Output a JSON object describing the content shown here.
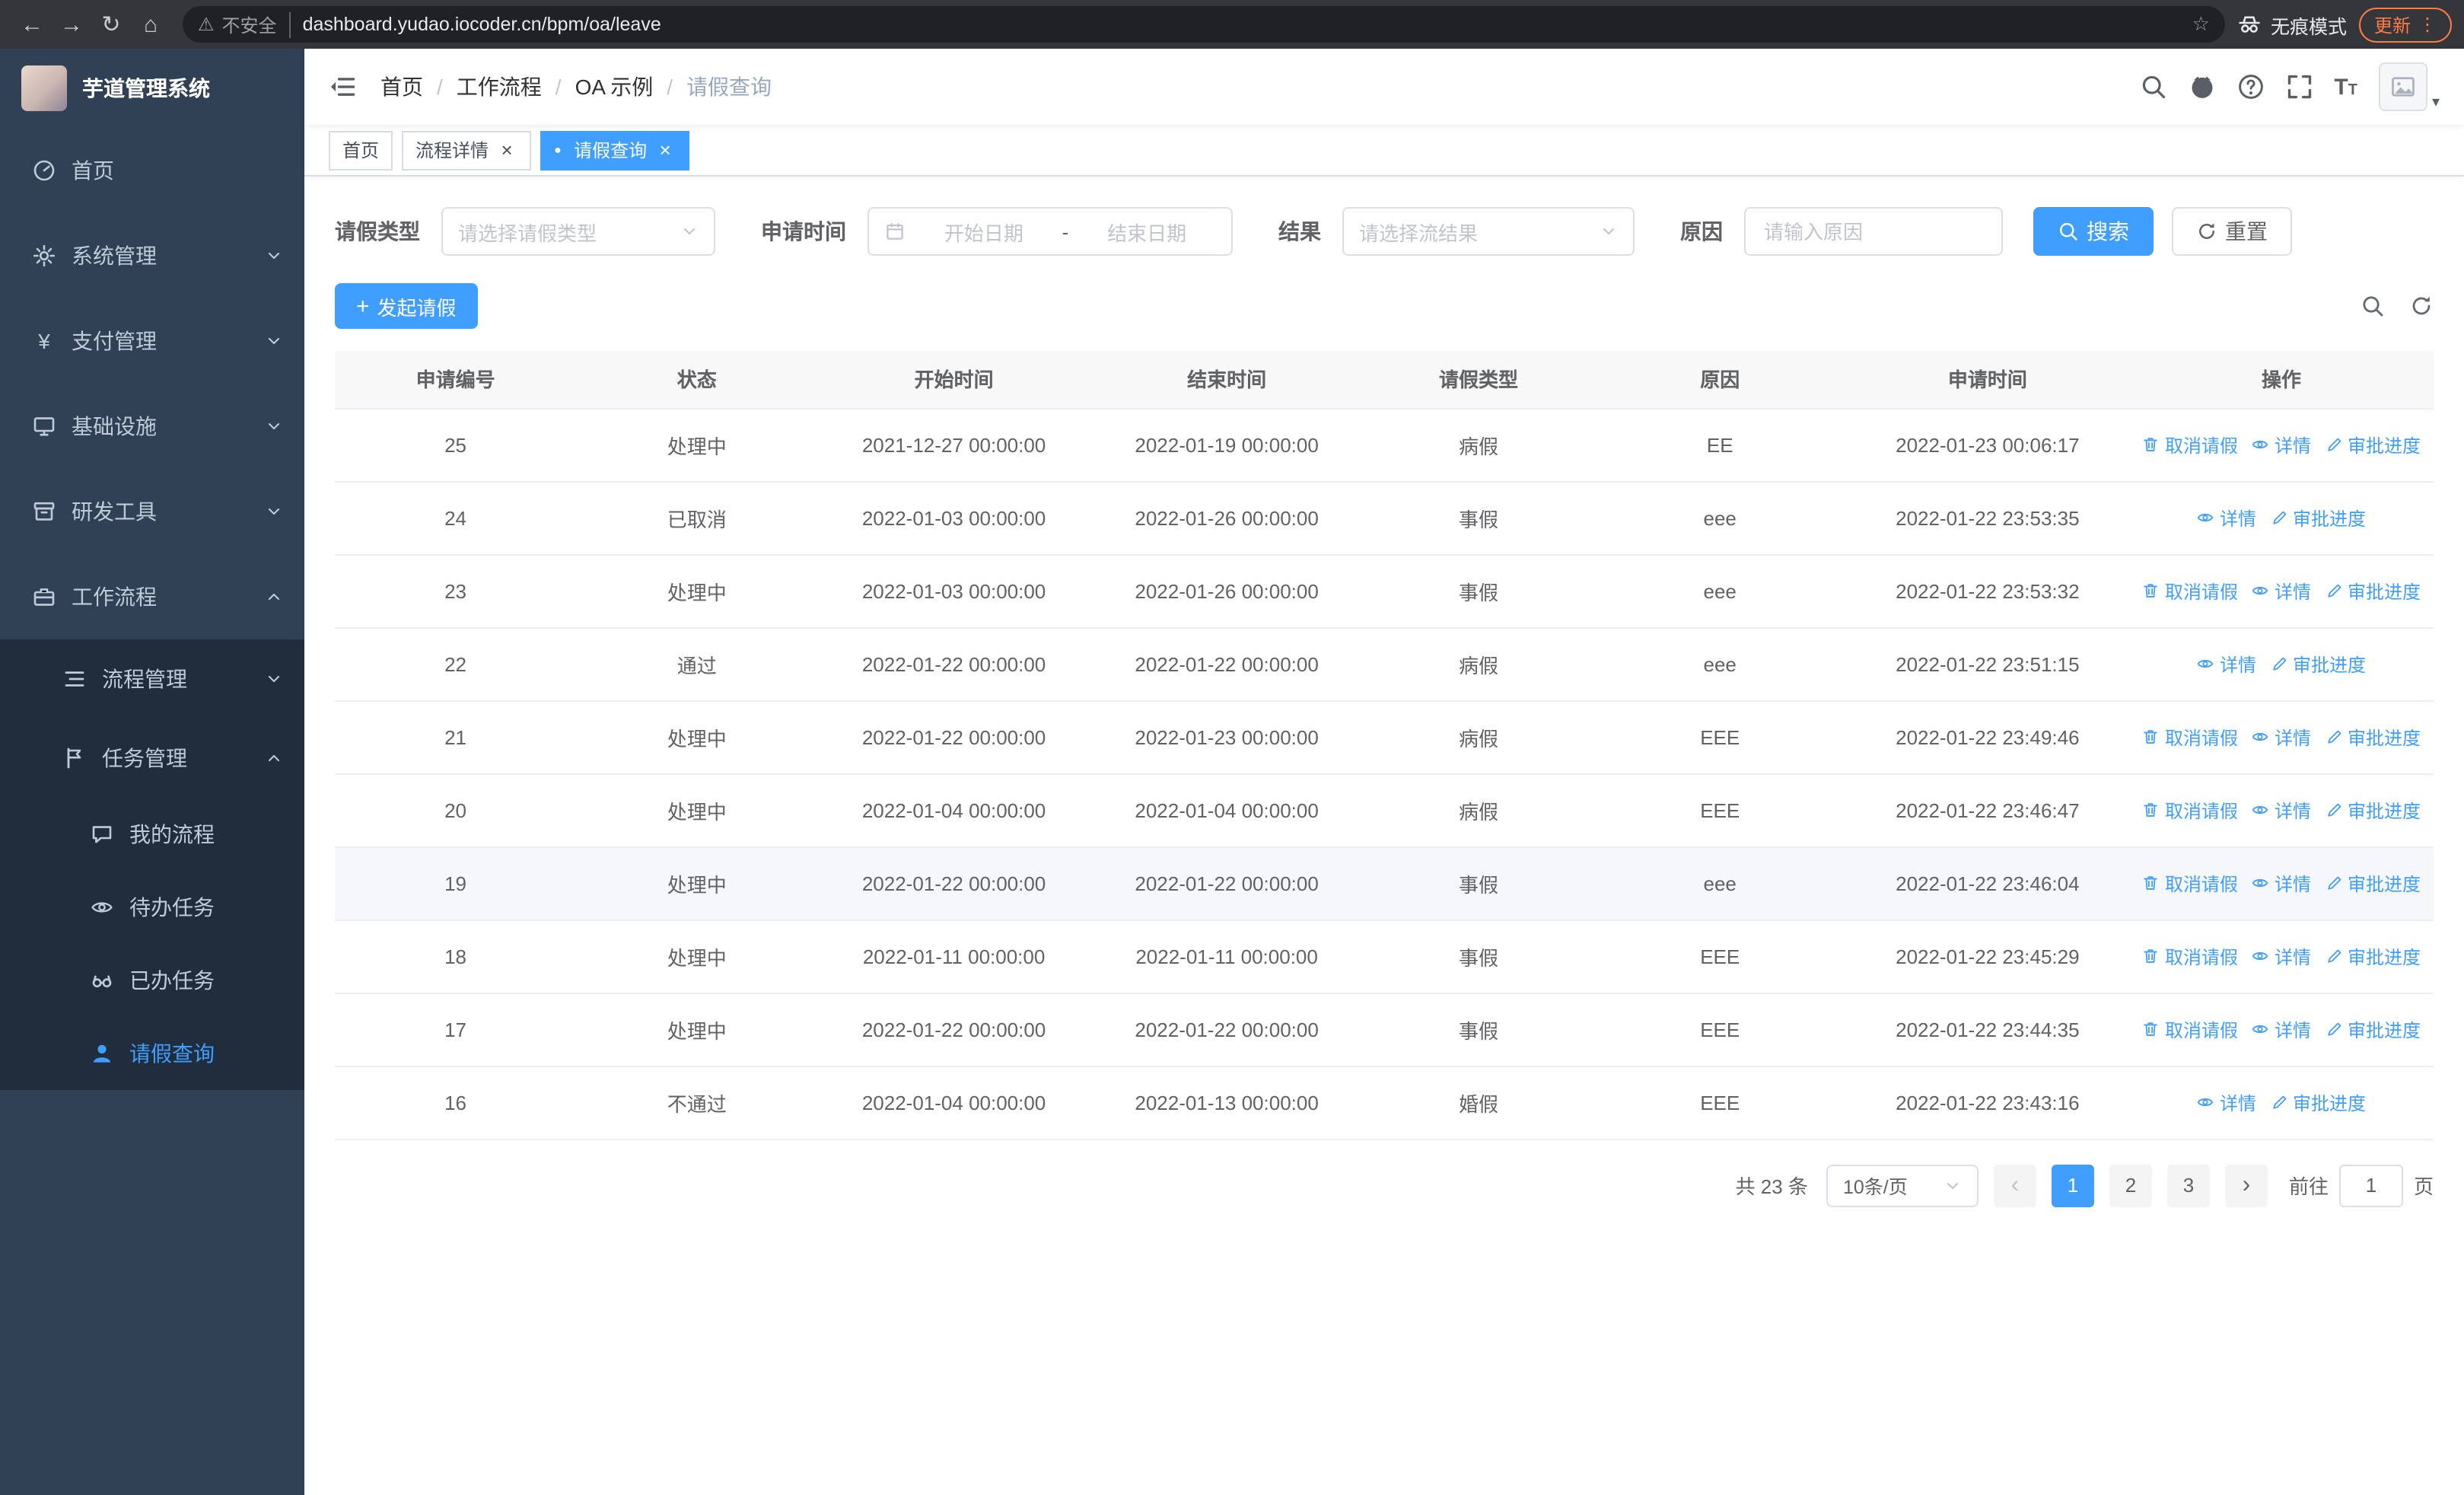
{
  "browser": {
    "security_label": "不安全",
    "url": "dashboard.yudao.iocoder.cn/bpm/oa/leave",
    "incognito_label": "无痕模式",
    "update_label": "更新"
  },
  "icons": {
    "back": "←",
    "forward": "→",
    "reload": "↻",
    "home": "⌂",
    "warning": "⚠",
    "star": "☆",
    "menu_dots": "⋮",
    "close": "×",
    "plus": "+",
    "yen": "¥",
    "active_dot": "●",
    "font_large": "T",
    "font_small": "T",
    "prev": "‹",
    "next": "›",
    "caret_down": "▾"
  },
  "sidebar": {
    "logo_title": "芋道管理系统",
    "items": [
      {
        "label": "首页"
      },
      {
        "label": "系统管理"
      },
      {
        "label": "支付管理"
      },
      {
        "label": "基础设施"
      },
      {
        "label": "研发工具"
      },
      {
        "label": "工作流程"
      },
      {
        "label": "流程管理"
      },
      {
        "label": "任务管理"
      },
      {
        "label": "我的流程"
      },
      {
        "label": "待办任务"
      },
      {
        "label": "已办任务"
      },
      {
        "label": "请假查询"
      }
    ]
  },
  "breadcrumb": {
    "separator": "/",
    "items": [
      "首页",
      "工作流程",
      "OA 示例",
      "请假查询"
    ]
  },
  "tabs": [
    {
      "label": "首页"
    },
    {
      "label": "流程详情"
    },
    {
      "label": "请假查询"
    }
  ],
  "filters": {
    "leave_type_label": "请假类型",
    "leave_type_placeholder": "请选择请假类型",
    "apply_time_label": "申请时间",
    "start_date_placeholder": "开始日期",
    "range_separator": "-",
    "end_date_placeholder": "结束日期",
    "result_label": "结果",
    "result_placeholder": "请选择流结果",
    "reason_label": "原因",
    "reason_placeholder": "请输入原因",
    "search_label": "搜索",
    "reset_label": "重置"
  },
  "toolbar": {
    "create_label": "发起请假"
  },
  "table": {
    "columns": [
      "申请编号",
      "状态",
      "开始时间",
      "结束时间",
      "请假类型",
      "原因",
      "申请时间",
      "操作"
    ],
    "actions": {
      "cancel": "取消请假",
      "detail": "详情",
      "progress": "审批进度"
    },
    "rows": [
      {
        "id": "25",
        "status": "处理中",
        "start": "2021-12-27 00:00:00",
        "end": "2022-01-19 00:00:00",
        "type": "病假",
        "reason": "EE",
        "applied": "2022-01-23 00:06:17"
      },
      {
        "id": "24",
        "status": "已取消",
        "start": "2022-01-03 00:00:00",
        "end": "2022-01-26 00:00:00",
        "type": "事假",
        "reason": "eee",
        "applied": "2022-01-22 23:53:35"
      },
      {
        "id": "23",
        "status": "处理中",
        "start": "2022-01-03 00:00:00",
        "end": "2022-01-26 00:00:00",
        "type": "事假",
        "reason": "eee",
        "applied": "2022-01-22 23:53:32"
      },
      {
        "id": "22",
        "status": "通过",
        "start": "2022-01-22 00:00:00",
        "end": "2022-01-22 00:00:00",
        "type": "病假",
        "reason": "eee",
        "applied": "2022-01-22 23:51:15"
      },
      {
        "id": "21",
        "status": "处理中",
        "start": "2022-01-22 00:00:00",
        "end": "2022-01-23 00:00:00",
        "type": "病假",
        "reason": "EEE",
        "applied": "2022-01-22 23:49:46"
      },
      {
        "id": "20",
        "status": "处理中",
        "start": "2022-01-04 00:00:00",
        "end": "2022-01-04 00:00:00",
        "type": "病假",
        "reason": "EEE",
        "applied": "2022-01-22 23:46:47"
      },
      {
        "id": "19",
        "status": "处理中",
        "start": "2022-01-22 00:00:00",
        "end": "2022-01-22 00:00:00",
        "type": "事假",
        "reason": "eee",
        "applied": "2022-01-22 23:46:04"
      },
      {
        "id": "18",
        "status": "处理中",
        "start": "2022-01-11 00:00:00",
        "end": "2022-01-11 00:00:00",
        "type": "事假",
        "reason": "EEE",
        "applied": "2022-01-22 23:45:29"
      },
      {
        "id": "17",
        "status": "处理中",
        "start": "2022-01-22 00:00:00",
        "end": "2022-01-22 00:00:00",
        "type": "事假",
        "reason": "EEE",
        "applied": "2022-01-22 23:44:35"
      },
      {
        "id": "16",
        "status": "不通过",
        "start": "2022-01-04 00:00:00",
        "end": "2022-01-13 00:00:00",
        "type": "婚假",
        "reason": "EEE",
        "applied": "2022-01-22 23:43:16"
      }
    ]
  },
  "pagination": {
    "total": "共 23 条",
    "page_size": "10条/页",
    "pages": [
      "1",
      "2",
      "3"
    ],
    "goto_label": "前往",
    "goto_value": "1",
    "unit_label": "页"
  },
  "colors": {
    "accent": "#409eff",
    "sidebar_bg": "#304156",
    "submenu_bg": "#1f2d3d",
    "update_accent": "#ff7a45"
  }
}
